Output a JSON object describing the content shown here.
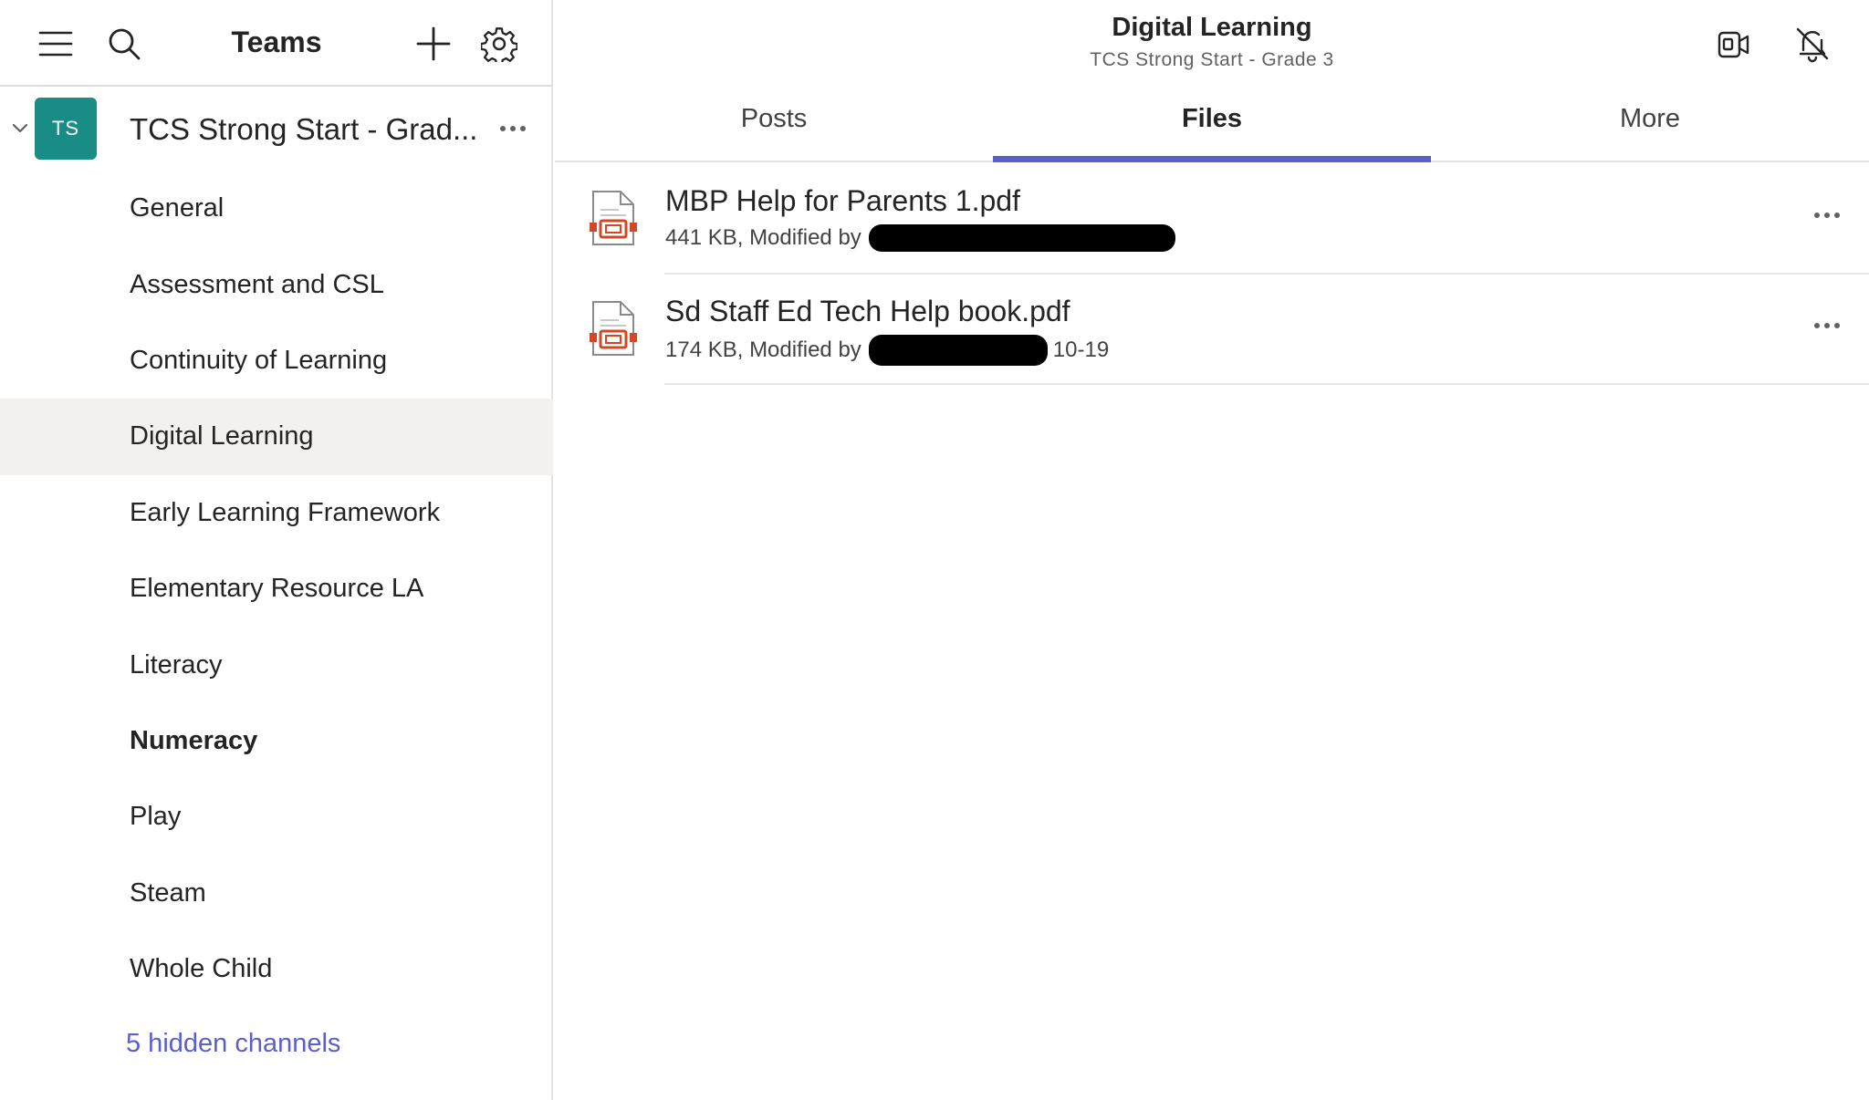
{
  "sidebar": {
    "title": "Teams",
    "menu_icon": "hamburger-menu-icon",
    "search_icon": "search-icon",
    "add_icon": "plus-icon",
    "settings_icon": "gear-icon",
    "team": {
      "avatar": "TS",
      "avatar_color": "#1a8c86",
      "name": "TCS Strong Start - Grad..."
    },
    "channels": [
      {
        "label": "General"
      },
      {
        "label": "Assessment and CSL"
      },
      {
        "label": "Continuity of Learning"
      },
      {
        "label": "Digital Learning"
      },
      {
        "label": "Early Learning Framework"
      },
      {
        "label": "Elementary Resource LA"
      },
      {
        "label": "Literacy"
      },
      {
        "label": "Numeracy"
      },
      {
        "label": "Play"
      },
      {
        "label": "Steam"
      },
      {
        "label": "Whole Child"
      }
    ],
    "active_channel": "Digital Learning",
    "unread_channel": "Numeracy",
    "hidden_channels": "5 hidden channels"
  },
  "header": {
    "title": "Digital Learning",
    "subtitle": "TCS Strong Start - Grade 3",
    "meet_icon": "video-call-icon",
    "notifications_icon": "bell-off-icon"
  },
  "tabs": [
    {
      "label": "Posts"
    },
    {
      "label": "Files"
    },
    {
      "label": "More"
    }
  ],
  "active_tab": "Files",
  "accent_color": "#5b5fc7",
  "files": [
    {
      "name": "MBP Help for Parents 1.pdf",
      "meta": "441 KB, Modified by",
      "suffix": "",
      "icon": "pdf-file-icon"
    },
    {
      "name": "Sd Staff Ed Tech Help book.pdf",
      "meta": "174 KB, Modified by",
      "suffix": "10-19",
      "icon": "pdf-file-icon"
    }
  ]
}
